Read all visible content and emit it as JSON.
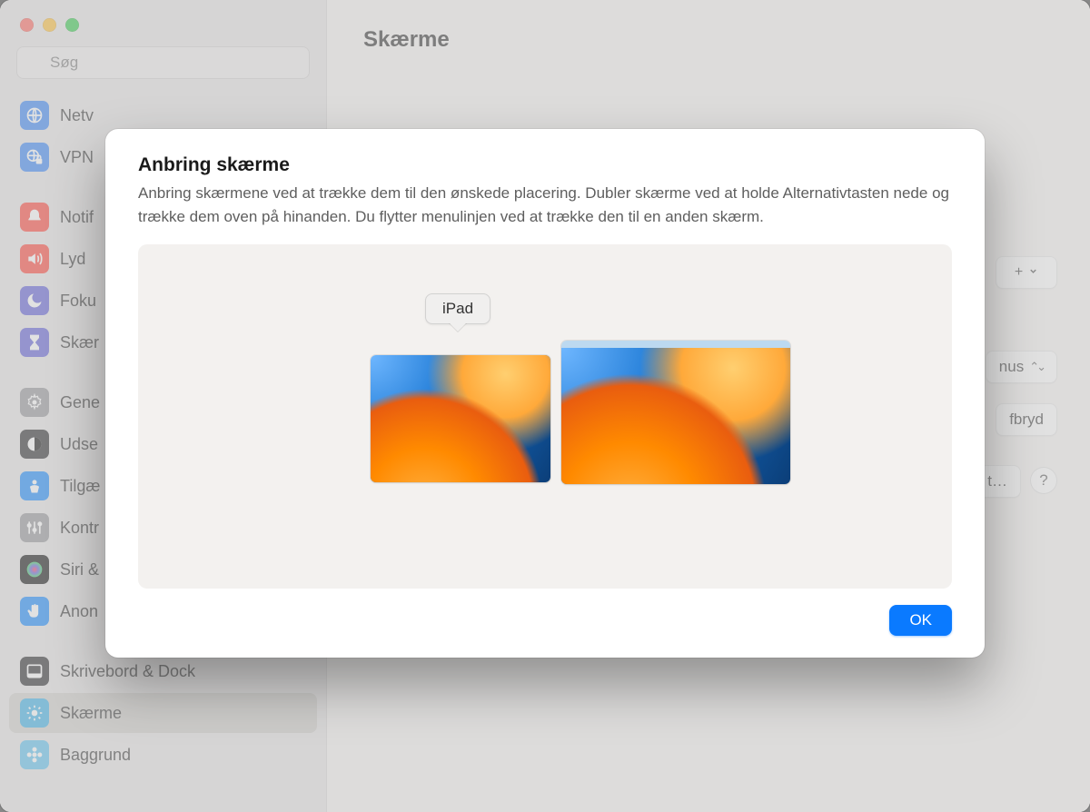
{
  "window": {
    "title": "Skærme"
  },
  "search": {
    "placeholder": "Søg"
  },
  "sidebar": {
    "items": [
      {
        "id": "network",
        "label": "Netv",
        "icon": "globe",
        "color": "#2d7ef7"
      },
      {
        "id": "vpn",
        "label": "VPN",
        "icon": "globe-lock",
        "color": "#2d7ef7"
      },
      {
        "gap": true
      },
      {
        "id": "notifications",
        "label": "Notif",
        "icon": "bell",
        "color": "#ff3b30"
      },
      {
        "id": "sound",
        "label": "Lyd",
        "icon": "speaker",
        "color": "#ff3b30"
      },
      {
        "id": "focus",
        "label": "Foku",
        "icon": "moon",
        "color": "#5856d6"
      },
      {
        "id": "screentime",
        "label": "Skær",
        "icon": "hourglass",
        "color": "#5856d6"
      },
      {
        "gap": true
      },
      {
        "id": "general",
        "label": "Gene",
        "icon": "gear",
        "color": "#8e8e93"
      },
      {
        "id": "appearance",
        "label": "Udse",
        "icon": "contrast",
        "color": "#1c1c1e"
      },
      {
        "id": "accessibility",
        "label": "Tilgæ",
        "icon": "person",
        "color": "#0a84ff"
      },
      {
        "id": "controlcenter",
        "label": "Kontr",
        "icon": "sliders",
        "color": "#8e8e93"
      },
      {
        "id": "siri",
        "label": "Siri &",
        "icon": "siri",
        "color": "#000000"
      },
      {
        "id": "privacy",
        "label": "Anon",
        "icon": "hand",
        "color": "#0a84ff"
      },
      {
        "gap": true
      },
      {
        "id": "deskdock",
        "label": "Skrivebord & Dock",
        "icon": "dock",
        "color": "#1c1c1e"
      },
      {
        "id": "displays",
        "label": "Skærme",
        "icon": "brightness",
        "color": "#32ade6",
        "active": true
      },
      {
        "id": "wallpaper",
        "label": "Baggrund",
        "icon": "flower",
        "color": "#55bef0"
      }
    ]
  },
  "main": {
    "add_label": "+",
    "popup1": "nus",
    "popup2": "fbryd",
    "popup3": "t…",
    "help": "?"
  },
  "modal": {
    "title": "Anbring skærme",
    "description": "Anbring skærmene ved at trække dem til den ønskede placering. Dubler skærme ved at holde Alternativtasten nede og trække dem oven på hinanden. Du flytter menulinjen ved at trække den til en anden skærm.",
    "tooltip_label": "iPad",
    "ok_label": "OK"
  }
}
